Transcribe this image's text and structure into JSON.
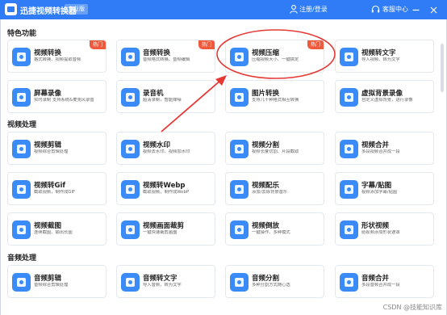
{
  "titlebar": {
    "app_title": "迅捷视频转换器",
    "edition": "专业版",
    "login": "注册/登录",
    "support": "客服中心"
  },
  "sections": [
    {
      "title": "特色功能",
      "cards": [
        {
          "name": "视频转换",
          "desc": "格式转换、视频提取音频",
          "badge": "热门",
          "icon": "video-convert-icon"
        },
        {
          "name": "音频转换",
          "desc": "音频格式转换、音频编辑",
          "badge": "热门",
          "icon": "audio-convert-icon"
        },
        {
          "name": "视频压缩",
          "desc": "压缩视频大小、一键搞定",
          "badge": "热门",
          "icon": "video-compress-icon"
        },
        {
          "name": "视频转文字",
          "desc": "导入视频、转为文字",
          "badge": "",
          "icon": "video-to-text-icon"
        },
        {
          "name": "屏幕录像",
          "desc": "实时录制 支持系统&麦克风录音",
          "badge": "",
          "icon": "screen-record-icon"
        },
        {
          "name": "录音机",
          "desc": "超清录制，智能降噪",
          "badge": "",
          "icon": "recorder-icon"
        },
        {
          "name": "图片转换",
          "desc": "支持几十种格式相互转换",
          "badge": "",
          "icon": "image-convert-icon"
        },
        {
          "name": "虚拟背景录像",
          "desc": "自定义虚拟背景，进行录像",
          "badge": "",
          "icon": "virtual-background-icon"
        }
      ]
    },
    {
      "title": "视频处理",
      "cards": [
        {
          "name": "视频剪辑",
          "desc": "视频综合剪辑处理",
          "badge": "",
          "icon": "video-edit-icon"
        },
        {
          "name": "视频水印",
          "desc": "视频去水印、视频加水印",
          "badge": "",
          "icon": "video-watermark-icon"
        },
        {
          "name": "视频分割",
          "desc": "视频长度切割、片段截取",
          "badge": "",
          "icon": "video-split-icon"
        },
        {
          "name": "视频合并",
          "desc": "多段视频合并成一段",
          "badge": "",
          "icon": "video-merge-icon"
        },
        {
          "name": "视频转Gif",
          "desc": "截取视频，制作成GIF",
          "badge": "",
          "icon": "video-to-gif-icon"
        },
        {
          "name": "视频转Webp",
          "desc": "截取视频，制作成WebP",
          "badge": "",
          "icon": "video-to-webp-icon"
        },
        {
          "name": "视频配乐",
          "desc": "添加/去除背景音乐",
          "badge": "",
          "icon": "video-music-icon"
        },
        {
          "name": "字幕/贴图",
          "desc": "视频添加字幕/贴图",
          "badge": "",
          "icon": "subtitle-sticker-icon"
        },
        {
          "name": "视频截图",
          "desc": "连续截图、输出长图",
          "badge": "",
          "icon": "video-screenshot-icon"
        },
        {
          "name": "视频画面裁剪",
          "desc": "一键快速裁剪画面",
          "badge": "",
          "icon": "video-crop-icon"
        },
        {
          "name": "视频倒放",
          "desc": "一键操作、多种模式",
          "badge": "",
          "icon": "video-reverse-icon"
        },
        {
          "name": "形状视频",
          "desc": "给视频添加形状遮罩",
          "badge": "",
          "icon": "shape-video-icon"
        }
      ]
    },
    {
      "title": "音频处理",
      "cards": [
        {
          "name": "音频剪辑",
          "desc": "音频综合剪辑处理",
          "badge": "",
          "icon": "audio-edit-icon"
        },
        {
          "name": "音频转文字",
          "desc": "导入音频，转为文字",
          "badge": "",
          "icon": "audio-to-text-icon"
        },
        {
          "name": "音频分割",
          "desc": "多种分割方式随心选",
          "badge": "",
          "icon": "audio-split-icon"
        },
        {
          "name": "音频合并",
          "desc": "多段音频合并成一段",
          "badge": "",
          "icon": "audio-merge-icon"
        }
      ]
    }
  ],
  "watermark": "CSDN @技能知识库",
  "colors": {
    "titlebar": "#2f7cf6",
    "icon": "#3a8bf8",
    "hot_badge": "#f05a3c",
    "annotation": "#e53935"
  }
}
